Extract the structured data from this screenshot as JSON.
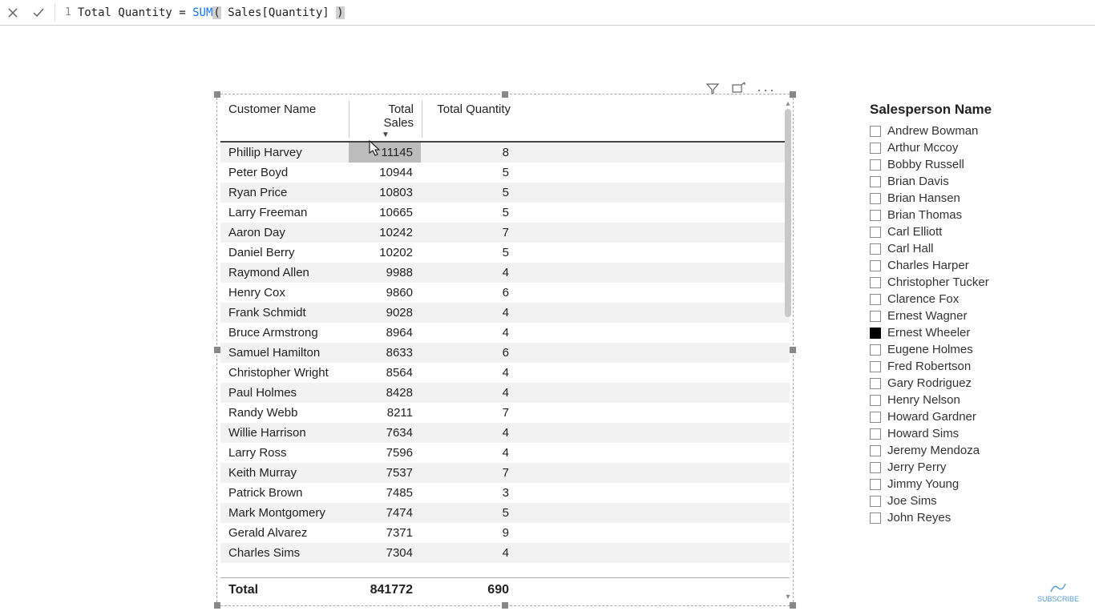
{
  "formula_bar": {
    "line_number": "1",
    "prefix": "Total Quantity = ",
    "fn": "SUM",
    "open": "(",
    "arg": " Sales[Quantity] ",
    "close": ")"
  },
  "visual_header": {
    "filter_icon": "filter-icon",
    "focus_icon": "focus-mode-icon",
    "more_icon": "more-options-icon"
  },
  "table": {
    "columns": [
      "Customer Name",
      "Total Sales",
      "Total Quantity"
    ],
    "sorted_column_index": 1,
    "rows": [
      {
        "name": "Phillip Harvey",
        "sales": "11145",
        "qty": "8"
      },
      {
        "name": "Peter Boyd",
        "sales": "10944",
        "qty": "5"
      },
      {
        "name": "Ryan Price",
        "sales": "10803",
        "qty": "5"
      },
      {
        "name": "Larry Freeman",
        "sales": "10665",
        "qty": "5"
      },
      {
        "name": "Aaron Day",
        "sales": "10242",
        "qty": "7"
      },
      {
        "name": "Daniel Berry",
        "sales": "10202",
        "qty": "5"
      },
      {
        "name": "Raymond Allen",
        "sales": "9988",
        "qty": "4"
      },
      {
        "name": "Henry Cox",
        "sales": "9860",
        "qty": "6"
      },
      {
        "name": "Frank Schmidt",
        "sales": "9028",
        "qty": "4"
      },
      {
        "name": "Bruce Armstrong",
        "sales": "8964",
        "qty": "4"
      },
      {
        "name": "Samuel Hamilton",
        "sales": "8633",
        "qty": "6"
      },
      {
        "name": "Christopher Wright",
        "sales": "8564",
        "qty": "4"
      },
      {
        "name": "Paul Holmes",
        "sales": "8428",
        "qty": "4"
      },
      {
        "name": "Randy Webb",
        "sales": "8211",
        "qty": "7"
      },
      {
        "name": "Willie Harrison",
        "sales": "7634",
        "qty": "4"
      },
      {
        "name": "Larry Ross",
        "sales": "7596",
        "qty": "4"
      },
      {
        "name": "Keith Murray",
        "sales": "7537",
        "qty": "7"
      },
      {
        "name": "Patrick Brown",
        "sales": "7485",
        "qty": "3"
      },
      {
        "name": "Mark Montgomery",
        "sales": "7474",
        "qty": "5"
      },
      {
        "name": "Gerald Alvarez",
        "sales": "7371",
        "qty": "9"
      },
      {
        "name": "Charles Sims",
        "sales": "7304",
        "qty": "4"
      }
    ],
    "total_label": "Total",
    "total_sales": "841772",
    "total_qty": "690"
  },
  "slicer": {
    "title": "Salesperson Name",
    "items": [
      {
        "label": "Andrew Bowman",
        "checked": false
      },
      {
        "label": "Arthur Mccoy",
        "checked": false
      },
      {
        "label": "Bobby Russell",
        "checked": false
      },
      {
        "label": "Brian Davis",
        "checked": false
      },
      {
        "label": "Brian Hansen",
        "checked": false
      },
      {
        "label": "Brian Thomas",
        "checked": false
      },
      {
        "label": "Carl Elliott",
        "checked": false
      },
      {
        "label": "Carl Hall",
        "checked": false
      },
      {
        "label": "Charles Harper",
        "checked": false
      },
      {
        "label": "Christopher Tucker",
        "checked": false
      },
      {
        "label": "Clarence Fox",
        "checked": false
      },
      {
        "label": "Ernest Wagner",
        "checked": false
      },
      {
        "label": "Ernest Wheeler",
        "checked": true
      },
      {
        "label": "Eugene Holmes",
        "checked": false
      },
      {
        "label": "Fred Robertson",
        "checked": false
      },
      {
        "label": "Gary Rodriguez",
        "checked": false
      },
      {
        "label": "Henry Nelson",
        "checked": false
      },
      {
        "label": "Howard Gardner",
        "checked": false
      },
      {
        "label": "Howard Sims",
        "checked": false
      },
      {
        "label": "Jeremy Mendoza",
        "checked": false
      },
      {
        "label": "Jerry Perry",
        "checked": false
      },
      {
        "label": "Jimmy Young",
        "checked": false
      },
      {
        "label": "Joe Sims",
        "checked": false
      },
      {
        "label": "John Reyes",
        "checked": false
      }
    ]
  },
  "badge": {
    "label": "SUBSCRIBE"
  }
}
